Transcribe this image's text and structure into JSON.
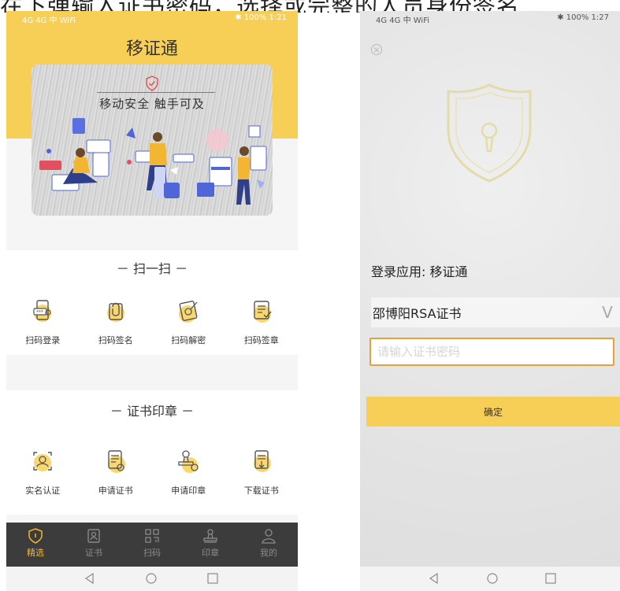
{
  "caption": "在下弹输入证书密码，选择或完整的人员身份签名",
  "left": {
    "status": {
      "left": "4G 4G 中 WiFi",
      "right": "✱ 100% 1:21"
    },
    "title": "移证通",
    "banner": {
      "slogan": "移动安全  触手可及"
    },
    "scan_section": {
      "title": "－ 扫一扫 －",
      "items": [
        {
          "label": "扫码登录",
          "icon": "phone-login-icon"
        },
        {
          "label": "扫码签名",
          "icon": "signature-icon"
        },
        {
          "label": "扫码解密",
          "icon": "decrypt-icon"
        },
        {
          "label": "扫码签章",
          "icon": "stamp-doc-icon"
        }
      ]
    },
    "cert_section": {
      "title": "－ 证书印章 －",
      "items": [
        {
          "label": "实名认证",
          "icon": "face-scan-icon"
        },
        {
          "label": "申请证书",
          "icon": "apply-cert-icon"
        },
        {
          "label": "申请印章",
          "icon": "apply-seal-icon"
        },
        {
          "label": "下载证书",
          "icon": "download-cert-icon"
        }
      ]
    },
    "tabs": [
      {
        "label": "精选",
        "active": true
      },
      {
        "label": "证书",
        "active": false
      },
      {
        "label": "扫码",
        "active": false
      },
      {
        "label": "印章",
        "active": false
      },
      {
        "label": "我的",
        "active": false
      }
    ]
  },
  "right": {
    "status": {
      "left": "4G 4G 中 WiFi",
      "right": "✱ 100% 1:27"
    },
    "login_app": "登录应用: 移证通",
    "cert_name": "邵博阳RSA证书",
    "chevron": "V",
    "password_placeholder": "请输入证书密码",
    "confirm_label": "确定"
  },
  "colors": {
    "accent": "#f7cf57",
    "tab_active": "#f2b632",
    "tabbar": "#3c3c3c",
    "input_border": "#e6a23c"
  }
}
